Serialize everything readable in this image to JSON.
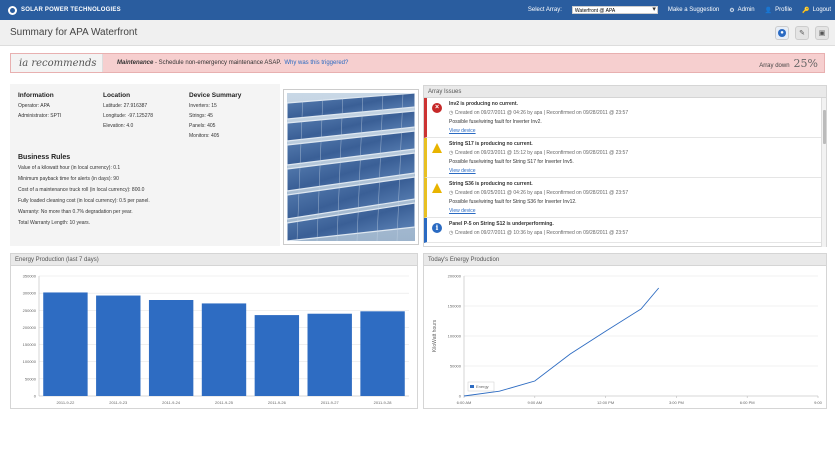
{
  "topbar": {
    "brand": "SOLAR POWER TECHNOLOGIES",
    "select_label": "Select Array:",
    "selected_array": "Waterfront @ APA",
    "suggestion": "Make a Suggestion",
    "admin": "Admin",
    "profile": "Profile",
    "logout": "Logout"
  },
  "page": {
    "title": "Summary for APA Waterfront"
  },
  "recommend": {
    "label": "ia recommends",
    "type": "Maintenance",
    "message": " - Schedule non-emergency maintenance ASAP.",
    "link": "Why was this triggered?",
    "status": "Array down",
    "percent": "25%"
  },
  "info": {
    "information_title": "Information",
    "operator": "Operator: APA",
    "administrator": "Administrator: SPTI",
    "location_title": "Location",
    "latitude": "Latitude: 27.916387",
    "longitude": "Longitude: -97.125278",
    "elevation": "Elevation: 4.0",
    "device_title": "Device Summary",
    "inverters": "Inverters: 15",
    "strings": "Strings: 45",
    "panels": "Panels: 405",
    "monitors": "Monitors: 405",
    "business_title": "Business Rules",
    "rules": [
      "Value of a kilowatt hour (in local currency): 0.1",
      "Minimum payback time for alerts (in days): 90",
      "Cost of a maintenance truck roll (in local currency): 800.0",
      "Fully loaded cleaning cost (in local currency): 0.5 per panel.",
      "Warranty: No more than 0.7% degradation per year.",
      "Total Warranty Length: 10 years."
    ]
  },
  "issues": {
    "header": "Array Issues",
    "items": [
      {
        "title": "Inv2 is producing no current.",
        "meta": "Created on 09/27/2011 @ 04:26 by apa  |  Reconfirmed on 09/28/2011 @ 23:57",
        "desc": "Possible fuse/wiring fault for Inverter Inv2.",
        "link": "View device"
      },
      {
        "title": "String S17 is producing no current.",
        "meta": "Created on 09/23/2011 @ 15:12 by apa  |  Reconfirmed on 09/28/2011 @ 23:57",
        "desc": "Possible fuse/wiring fault for String S17 for Inverter Inv5.",
        "link": "View device"
      },
      {
        "title": "String S36 is producing no current.",
        "meta": "Created on 09/25/2011 @ 04:26 by apa  |  Reconfirmed on 09/28/2011 @ 23:57",
        "desc": "Possible fuse/wiring fault for String S36 for Inverter Inv12.",
        "link": "View device"
      },
      {
        "title": "Panel P-5 on String S12 is underperforming.",
        "meta": "Created on 09/27/2011 @ 10:36 by apa  |  Reconfirmed on 09/28/2011 @ 23:57",
        "desc": "",
        "link": ""
      }
    ]
  },
  "chart_data": [
    {
      "type": "bar",
      "title": "Energy Production (last 7 days)",
      "categories": [
        "2011-9-22",
        "2011-9-23",
        "2011-9-24",
        "2011-9-25",
        "2011-9-26",
        "2011-9-27",
        "2011-9-28"
      ],
      "values": [
        302000,
        293000,
        280000,
        270000,
        236000,
        240000,
        247000
      ],
      "ylim": [
        0,
        350000
      ],
      "yticks": [
        "0",
        "50000",
        "100000",
        "150000",
        "200000",
        "250000",
        "300000",
        "350000"
      ],
      "color": "#2e6cc2",
      "grid": true
    },
    {
      "type": "line",
      "title": "Today's Energy Production",
      "ylabel": "KiloWatt hours",
      "x": [
        "6:00 AM",
        "7:30 AM",
        "9:00 AM",
        "10:30 AM",
        "12:00 PM",
        "1:30 PM",
        "2:15 PM"
      ],
      "series": [
        {
          "name": "Energy",
          "values": [
            0,
            8000,
            25000,
            70000,
            108000,
            145000,
            180000
          ]
        }
      ],
      "x_positions": [
        0,
        1.5,
        3,
        4.5,
        6,
        7.5,
        8.25
      ],
      "xticks": [
        "6:00 AM",
        "9:00 AM",
        "12:00 PM",
        "3:00 PM",
        "6:00 PM",
        "9:00"
      ],
      "yticks": [
        "0",
        "50000",
        "100000",
        "150000",
        "200000"
      ],
      "ylim": [
        0,
        200000
      ],
      "color": "#2e6cc2",
      "legend": "bottom-left"
    }
  ]
}
